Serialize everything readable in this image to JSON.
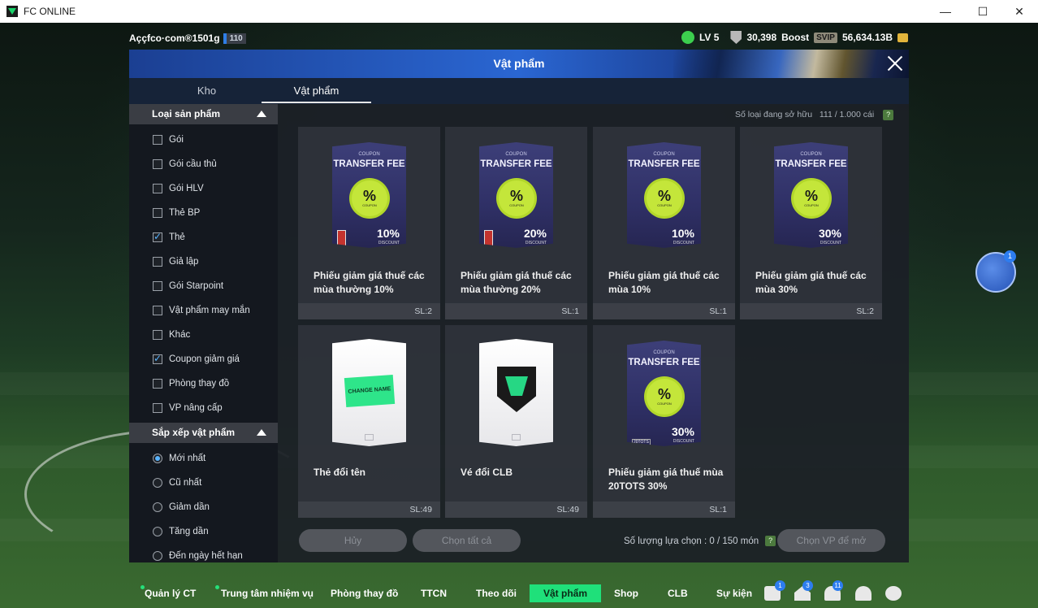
{
  "window": {
    "title": "FC ONLINE",
    "controls": {
      "minimize": "—",
      "maximize": "☐",
      "close": "✕"
    }
  },
  "hud": {
    "username": "Aççfco·com®1501g",
    "level_badge": "110",
    "lv": "LV 5",
    "points": "30,398",
    "boost": "Boost",
    "svip": "SVIP",
    "coins": "56,634.13B"
  },
  "modal": {
    "title": "Vật phẩm",
    "tabs": [
      {
        "label": "Kho",
        "active": false
      },
      {
        "label": "Vật phẩm",
        "active": true
      }
    ],
    "owned_label": "Số loại đang sở hữu",
    "owned_value": "111 / 1.000 cái",
    "help": "?"
  },
  "sidebar": {
    "product_type_header": "Loại sản phẩm",
    "product_types": [
      {
        "label": "Gói",
        "checked": false
      },
      {
        "label": "Gói cầu thủ",
        "checked": false
      },
      {
        "label": "Gói HLV",
        "checked": false
      },
      {
        "label": "Thẻ BP",
        "checked": false
      },
      {
        "label": "Thẻ",
        "checked": true
      },
      {
        "label": "Giả lập",
        "checked": false
      },
      {
        "label": "Gói Starpoint",
        "checked": false
      },
      {
        "label": "Vật phẩm may mắn",
        "checked": false
      },
      {
        "label": "Khác",
        "checked": false
      },
      {
        "label": "Coupon giảm giá",
        "checked": true
      },
      {
        "label": "Phòng thay đồ",
        "checked": false
      },
      {
        "label": "VP nâng cấp",
        "checked": false
      }
    ],
    "sort_header": "Sắp xếp vật phẩm",
    "sort_options": [
      {
        "label": "Mới nhất",
        "checked": true
      },
      {
        "label": "Cũ nhất",
        "checked": false
      },
      {
        "label": "Giảm dần",
        "checked": false
      },
      {
        "label": "Tăng dần",
        "checked": false
      },
      {
        "label": "Đến ngày hết hạn",
        "checked": false
      }
    ]
  },
  "items": [
    {
      "name": "Phiếu giảm giá thuế các mùa thường 10%",
      "qty": "SL:2",
      "type": "coupon",
      "coupon_small": "COUPON",
      "coupon_title": "TRANSFER FEE",
      "badge": "%",
      "badge_sub": "COUPON",
      "discount": "10",
      "discount_unit": "%",
      "discount_label": "DISCOUNT"
    },
    {
      "name": "Phiếu giảm giá thuế các mùa thường 20%",
      "qty": "SL:1",
      "type": "coupon",
      "coupon_small": "COUPON",
      "coupon_title": "TRANSFER FEE",
      "badge": "%",
      "badge_sub": "COUPON",
      "discount": "20",
      "discount_unit": "%",
      "discount_label": "DISCOUNT"
    },
    {
      "name": "Phiếu giảm giá thuế các mùa 10%",
      "qty": "SL:1",
      "type": "coupon",
      "coupon_small": "COUPON",
      "coupon_title": "TRANSFER FEE",
      "badge": "%",
      "badge_sub": "COUPON",
      "discount": "10",
      "discount_unit": "%",
      "discount_label": "DISCOUNT"
    },
    {
      "name": "Phiếu giảm giá thuế các mùa 30%",
      "qty": "SL:2",
      "type": "coupon",
      "coupon_small": "COUPON",
      "coupon_title": "TRANSFER FEE",
      "badge": "%",
      "badge_sub": "COUPON",
      "discount": "30",
      "discount_unit": "%",
      "discount_label": "DISCOUNT"
    },
    {
      "name": "Thẻ đổi tên",
      "qty": "SL:49",
      "type": "rename",
      "ticket_text": "CHANGE NAME"
    },
    {
      "name": "Vé đổi CLB",
      "qty": "SL:49",
      "type": "club"
    },
    {
      "name": "Phiếu giảm giá thuế mùa 20TOTS 30%",
      "qty": "SL:1",
      "type": "coupon",
      "coupon_small": "COUPON",
      "coupon_title": "TRANSFER FEE",
      "badge": "%",
      "badge_sub": "COUPON",
      "discount": "30",
      "discount_unit": "%",
      "discount_label": "DISCOUNT",
      "season_tag": "20TOTS"
    }
  ],
  "actions": {
    "cancel": "Hủy",
    "select_all": "Chọn tất cả",
    "selection_label": "Số lượng lựa chọn : 0 / 150 món",
    "help": "?",
    "choose_vp": "Chọn VP để mở"
  },
  "chat": {
    "count": "1"
  },
  "bottom_nav": {
    "items": [
      {
        "label": "Quản lý CT",
        "dot": true
      },
      {
        "label": "Trung tâm nhiệm vụ",
        "dot": true
      },
      {
        "label": "Phòng thay đồ",
        "dot": false
      },
      {
        "label": "TTCN",
        "dot": false
      },
      {
        "label": "Theo dõi",
        "dot": false
      },
      {
        "label": "Vật phẩm",
        "active": true
      },
      {
        "label": "Shop",
        "dot": false
      },
      {
        "label": "CLB",
        "dot": false
      },
      {
        "label": "Sự kiện",
        "dot": false
      }
    ],
    "icons": [
      {
        "name": "chat-icon",
        "badge": "1"
      },
      {
        "name": "home-icon",
        "badge": "3"
      },
      {
        "name": "bell-icon",
        "badge": "11"
      },
      {
        "name": "profile-icon",
        "badge": ""
      },
      {
        "name": "settings-icon",
        "badge": ""
      }
    ]
  },
  "colors": {
    "accent_green": "#1fe07a",
    "header_blue": "#2a66d2",
    "coupon_purple": "#3d3f79",
    "badge_lime": "#c4e63a",
    "check_blue": "#5ab4ff"
  }
}
